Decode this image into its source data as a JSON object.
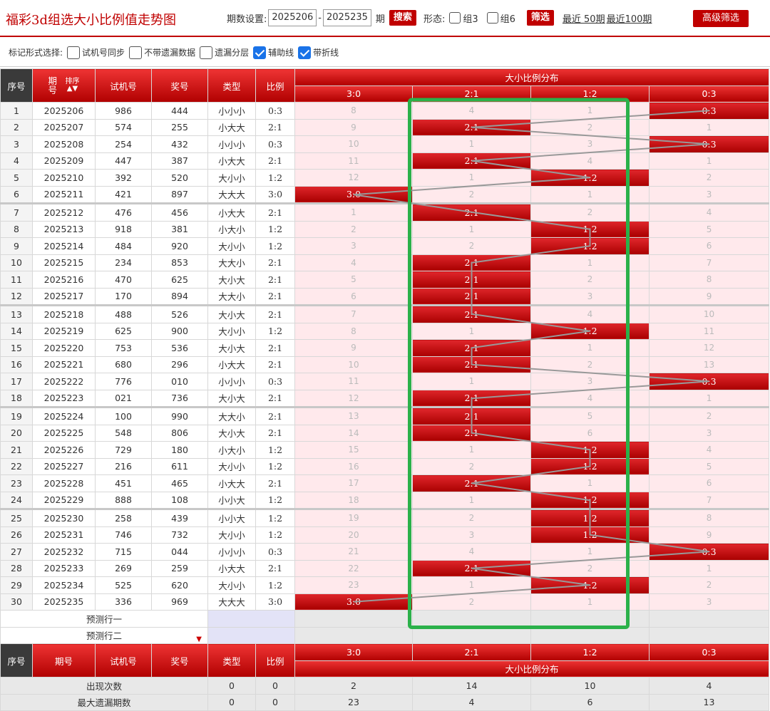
{
  "header": {
    "title": "福彩3d组选大小比例值走势图",
    "period_label": "期数设置:",
    "start_period": "2025206",
    "dash": "-",
    "end_period": "2025235",
    "period_unit": "期",
    "search_btn": "搜索",
    "form_label": "形态:",
    "group3": "组3",
    "group6": "组6",
    "filter_btn": "筛选",
    "recent50": "最近 50期",
    "recent100": "最近100期",
    "advanced_btn": "高级筛选"
  },
  "markbar": {
    "label": "标记形式选择:",
    "options": [
      {
        "label": "试机号同步",
        "checked": false
      },
      {
        "label": "不带遗漏数据",
        "checked": false
      },
      {
        "label": "遗漏分层",
        "checked": false
      },
      {
        "label": "辅助线",
        "checked": true
      },
      {
        "label": "带折线",
        "checked": true
      }
    ]
  },
  "columns": {
    "seq": "序号",
    "period": "期号",
    "sort": "排序",
    "trial": "试机号",
    "prize": "奖号",
    "type": "类型",
    "ratio": "比例",
    "dist_title": "大小比例分布",
    "ratios": [
      "3:0",
      "2:1",
      "1:2",
      "0:3"
    ]
  },
  "rows": [
    {
      "seq": "1",
      "period": "2025206",
      "trial": "986",
      "prize": "444",
      "type": "小小小",
      "ratio": "0:3",
      "dist": [
        "8",
        "4",
        "1",
        "0:3"
      ],
      "hit": 3
    },
    {
      "seq": "2",
      "period": "2025207",
      "trial": "574",
      "prize": "255",
      "type": "小大大",
      "ratio": "2:1",
      "dist": [
        "9",
        "2:1",
        "2",
        "1"
      ],
      "hit": 1
    },
    {
      "seq": "3",
      "period": "2025208",
      "trial": "254",
      "prize": "432",
      "type": "小小小",
      "ratio": "0:3",
      "dist": [
        "10",
        "1",
        "3",
        "0:3"
      ],
      "hit": 3
    },
    {
      "seq": "4",
      "period": "2025209",
      "trial": "447",
      "prize": "387",
      "type": "小大大",
      "ratio": "2:1",
      "dist": [
        "11",
        "2:1",
        "4",
        "1"
      ],
      "hit": 1
    },
    {
      "seq": "5",
      "period": "2025210",
      "trial": "392",
      "prize": "520",
      "type": "大小小",
      "ratio": "1:2",
      "dist": [
        "12",
        "1",
        "1:2",
        "2"
      ],
      "hit": 2
    },
    {
      "seq": "6",
      "period": "2025211",
      "trial": "421",
      "prize": "897",
      "type": "大大大",
      "ratio": "3:0",
      "dist": [
        "3:0",
        "2",
        "1",
        "3"
      ],
      "hit": 0
    },
    {
      "seq": "7",
      "period": "2025212",
      "trial": "476",
      "prize": "456",
      "type": "小大大",
      "ratio": "2:1",
      "dist": [
        "1",
        "2:1",
        "2",
        "4"
      ],
      "hit": 1
    },
    {
      "seq": "8",
      "period": "2025213",
      "trial": "918",
      "prize": "381",
      "type": "小大小",
      "ratio": "1:2",
      "dist": [
        "2",
        "1",
        "1:2",
        "5"
      ],
      "hit": 2
    },
    {
      "seq": "9",
      "period": "2025214",
      "trial": "484",
      "prize": "920",
      "type": "大小小",
      "ratio": "1:2",
      "dist": [
        "3",
        "2",
        "1:2",
        "6"
      ],
      "hit": 2
    },
    {
      "seq": "10",
      "period": "2025215",
      "trial": "234",
      "prize": "853",
      "type": "大大小",
      "ratio": "2:1",
      "dist": [
        "4",
        "2:1",
        "1",
        "7"
      ],
      "hit": 1
    },
    {
      "seq": "11",
      "period": "2025216",
      "trial": "470",
      "prize": "625",
      "type": "大小大",
      "ratio": "2:1",
      "dist": [
        "5",
        "2:1",
        "2",
        "8"
      ],
      "hit": 1
    },
    {
      "seq": "12",
      "period": "2025217",
      "trial": "170",
      "prize": "894",
      "type": "大大小",
      "ratio": "2:1",
      "dist": [
        "6",
        "2:1",
        "3",
        "9"
      ],
      "hit": 1
    },
    {
      "seq": "13",
      "period": "2025218",
      "trial": "488",
      "prize": "526",
      "type": "大小大",
      "ratio": "2:1",
      "dist": [
        "7",
        "2:1",
        "4",
        "10"
      ],
      "hit": 1
    },
    {
      "seq": "14",
      "period": "2025219",
      "trial": "625",
      "prize": "900",
      "type": "大小小",
      "ratio": "1:2",
      "dist": [
        "8",
        "1",
        "1:2",
        "11"
      ],
      "hit": 2
    },
    {
      "seq": "15",
      "period": "2025220",
      "trial": "753",
      "prize": "536",
      "type": "大小大",
      "ratio": "2:1",
      "dist": [
        "9",
        "2:1",
        "1",
        "12"
      ],
      "hit": 1
    },
    {
      "seq": "16",
      "period": "2025221",
      "trial": "680",
      "prize": "296",
      "type": "小大大",
      "ratio": "2:1",
      "dist": [
        "10",
        "2:1",
        "2",
        "13"
      ],
      "hit": 1
    },
    {
      "seq": "17",
      "period": "2025222",
      "trial": "776",
      "prize": "010",
      "type": "小小小",
      "ratio": "0:3",
      "dist": [
        "11",
        "1",
        "3",
        "0:3"
      ],
      "hit": 3
    },
    {
      "seq": "18",
      "period": "2025223",
      "trial": "021",
      "prize": "736",
      "type": "大小大",
      "ratio": "2:1",
      "dist": [
        "12",
        "2:1",
        "4",
        "1"
      ],
      "hit": 1
    },
    {
      "seq": "19",
      "period": "2025224",
      "trial": "100",
      "prize": "990",
      "type": "大大小",
      "ratio": "2:1",
      "dist": [
        "13",
        "2:1",
        "5",
        "2"
      ],
      "hit": 1
    },
    {
      "seq": "20",
      "period": "2025225",
      "trial": "548",
      "prize": "806",
      "type": "大小大",
      "ratio": "2:1",
      "dist": [
        "14",
        "2:1",
        "6",
        "3"
      ],
      "hit": 1
    },
    {
      "seq": "21",
      "period": "2025226",
      "trial": "729",
      "prize": "180",
      "type": "小大小",
      "ratio": "1:2",
      "dist": [
        "15",
        "1",
        "1:2",
        "4"
      ],
      "hit": 2
    },
    {
      "seq": "22",
      "period": "2025227",
      "trial": "216",
      "prize": "611",
      "type": "大小小",
      "ratio": "1:2",
      "dist": [
        "16",
        "2",
        "1:2",
        "5"
      ],
      "hit": 2
    },
    {
      "seq": "23",
      "period": "2025228",
      "trial": "451",
      "prize": "465",
      "type": "小大大",
      "ratio": "2:1",
      "dist": [
        "17",
        "2:1",
        "1",
        "6"
      ],
      "hit": 1
    },
    {
      "seq": "24",
      "period": "2025229",
      "trial": "888",
      "prize": "108",
      "type": "小小大",
      "ratio": "1:2",
      "dist": [
        "18",
        "1",
        "1:2",
        "7"
      ],
      "hit": 2
    },
    {
      "seq": "25",
      "period": "2025230",
      "trial": "258",
      "prize": "439",
      "type": "小小大",
      "ratio": "1:2",
      "dist": [
        "19",
        "2",
        "1:2",
        "8"
      ],
      "hit": 2
    },
    {
      "seq": "26",
      "period": "2025231",
      "trial": "746",
      "prize": "732",
      "type": "大小小",
      "ratio": "1:2",
      "dist": [
        "20",
        "3",
        "1:2",
        "9"
      ],
      "hit": 2
    },
    {
      "seq": "27",
      "period": "2025232",
      "trial": "715",
      "prize": "044",
      "type": "小小小",
      "ratio": "0:3",
      "dist": [
        "21",
        "4",
        "1",
        "0:3"
      ],
      "hit": 3
    },
    {
      "seq": "28",
      "period": "2025233",
      "trial": "269",
      "prize": "259",
      "type": "小大大",
      "ratio": "2:1",
      "dist": [
        "22",
        "2:1",
        "2",
        "1"
      ],
      "hit": 1
    },
    {
      "seq": "29",
      "period": "2025234",
      "trial": "525",
      "prize": "620",
      "type": "大小小",
      "ratio": "1:2",
      "dist": [
        "23",
        "1",
        "1:2",
        "2"
      ],
      "hit": 2
    },
    {
      "seq": "30",
      "period": "2025235",
      "trial": "336",
      "prize": "969",
      "type": "大大大",
      "ratio": "3:0",
      "dist": [
        "3:0",
        "2",
        "1",
        "3"
      ],
      "hit": 0
    }
  ],
  "predict": {
    "row1": "预测行一",
    "row2": "预测行二",
    "arrow": "▼"
  },
  "stats": [
    {
      "label": "出现次数",
      "type": "0",
      "ratio": "0",
      "values": [
        "2",
        "14",
        "10",
        "4"
      ]
    },
    {
      "label": "最大遗漏期数",
      "type": "0",
      "ratio": "0",
      "values": [
        "23",
        "4",
        "6",
        "13"
      ]
    }
  ],
  "colors": {
    "brand_red": "#c00000",
    "highlight_green": "#2bb14a",
    "line_gray": "#999999"
  }
}
